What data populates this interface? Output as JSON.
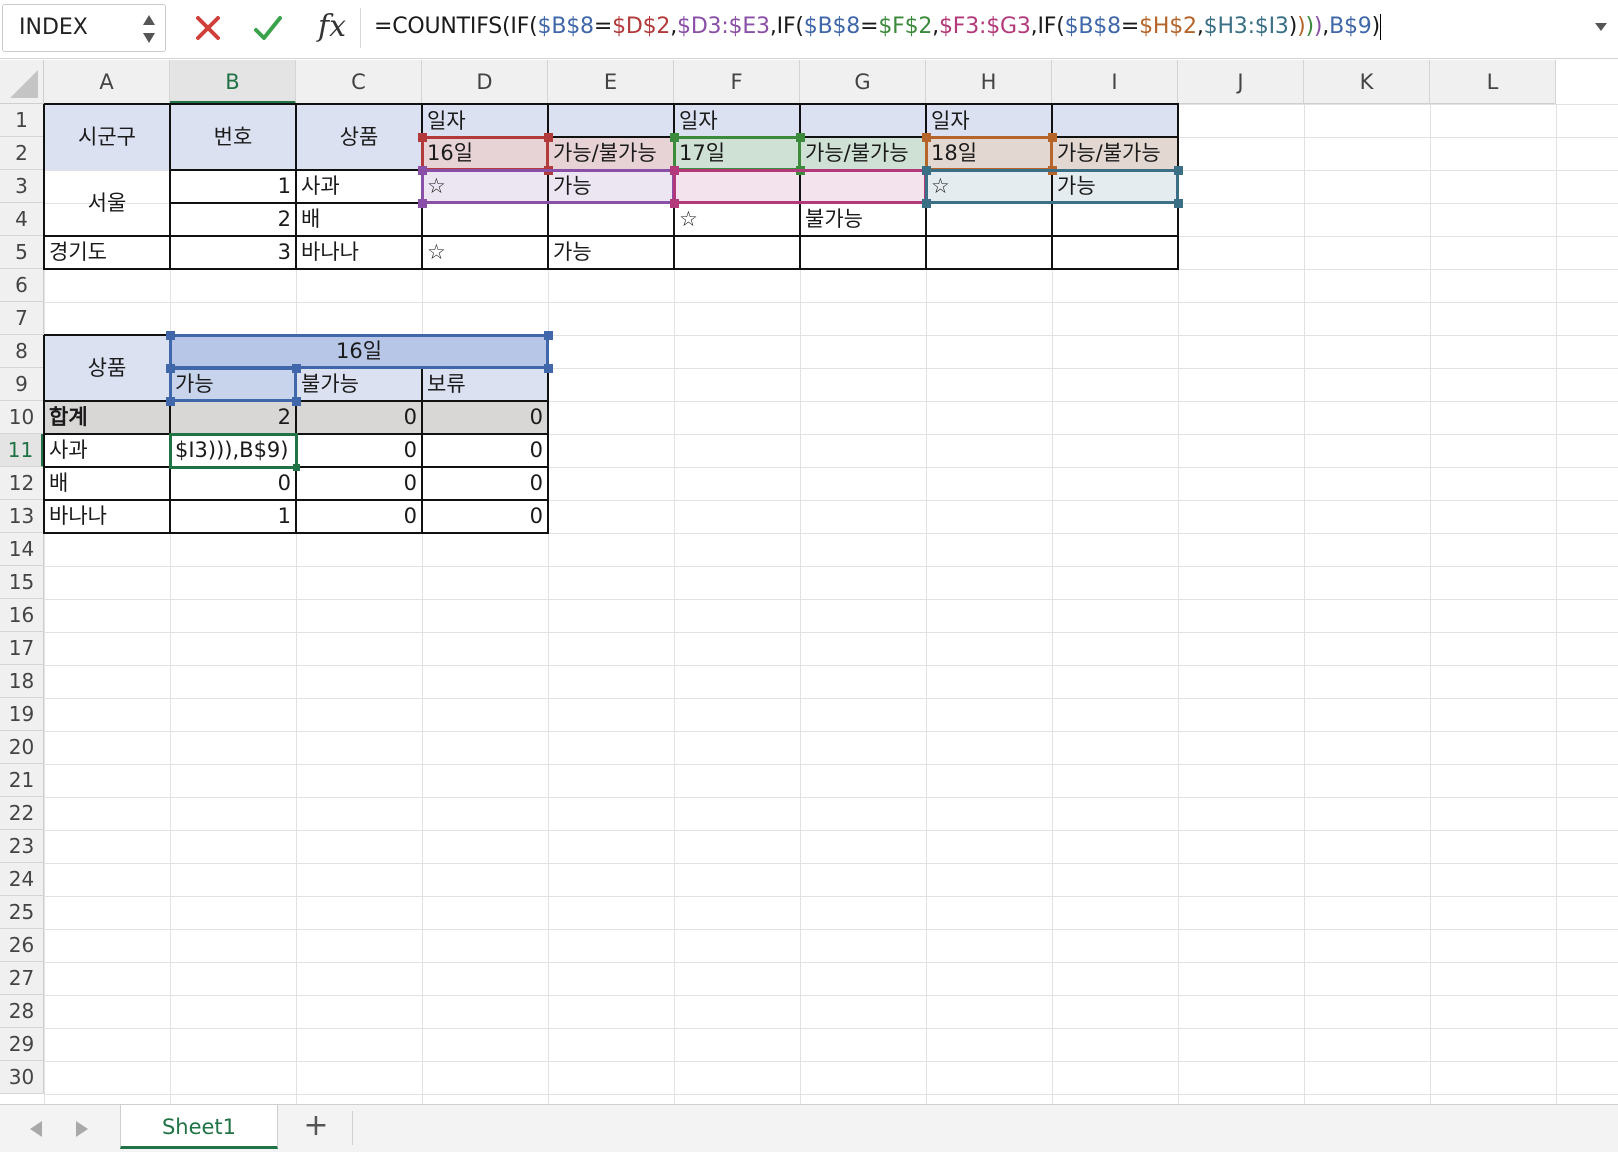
{
  "formula_bar": {
    "name_box": "INDEX",
    "cancel_icon": "x-icon",
    "enter_icon": "check-icon",
    "fx_label": "fx",
    "formula_segments": [
      {
        "text": "=COUNTIFS(IF(",
        "color": "#1a1a1a"
      },
      {
        "text": "$B$8",
        "color": "#3f67a9"
      },
      {
        "text": "=",
        "color": "#1a1a1a"
      },
      {
        "text": "$D$2",
        "color": "#b23a3a"
      },
      {
        "text": ",",
        "color": "#1a1a1a"
      },
      {
        "text": "$D3:$E3",
        "color": "#8a4fa6"
      },
      {
        "text": ",IF(",
        "color": "#1a1a1a"
      },
      {
        "text": "$B$8",
        "color": "#3f67a9"
      },
      {
        "text": "=",
        "color": "#1a1a1a"
      },
      {
        "text": "$F$2",
        "color": "#3c8a3c"
      },
      {
        "text": ",",
        "color": "#1a1a1a"
      },
      {
        "text": "$F3:$G3",
        "color": "#b23a7a"
      },
      {
        "text": ",IF(",
        "color": "#1a1a1a"
      },
      {
        "text": "$B$8",
        "color": "#3f67a9"
      },
      {
        "text": "=",
        "color": "#1a1a1a"
      },
      {
        "text": "$H$2",
        "color": "#b5652a"
      },
      {
        "text": ",",
        "color": "#1a1a1a"
      },
      {
        "text": "$H3:$I3",
        "color": "#3a6f86"
      },
      {
        "text": ")",
        "color": "#1a1a1a"
      },
      {
        "text": ")",
        "color": "#b5652a"
      },
      {
        "text": ")",
        "color": "#3c8a3c"
      },
      {
        "text": ")",
        "color": "#8a4fa6"
      },
      {
        "text": ",",
        "color": "#1a1a1a"
      },
      {
        "text": "B$9",
        "color": "#3f67a9"
      },
      {
        "text": ")",
        "color": "#1a1a1a"
      }
    ]
  },
  "columns": [
    "A",
    "B",
    "C",
    "D",
    "E",
    "F",
    "G",
    "H",
    "I",
    "J",
    "K",
    "L"
  ],
  "selected_column": "B",
  "rows": [
    "1",
    "2",
    "3",
    "4",
    "5",
    "6",
    "7",
    "8",
    "9",
    "10",
    "11",
    "12",
    "13",
    "14",
    "15",
    "16",
    "17",
    "18",
    "19",
    "20",
    "21",
    "22",
    "23",
    "24",
    "25",
    "26",
    "27",
    "28",
    "29",
    "30"
  ],
  "selected_row": "11",
  "cells": {
    "A1": "시군구",
    "B1": "번호",
    "C1": "상품",
    "D1": "일자",
    "F1": "일자",
    "H1": "일자",
    "D2": "16일",
    "E2": "가능/불가능",
    "F2": "17일",
    "G2": "가능/불가능",
    "H2": "18일",
    "I2": "가능/불가능",
    "A3": "서울",
    "B3": "1",
    "C3": "사과",
    "D3": "☆",
    "E3": "가능",
    "H3": "☆",
    "I3": "가능",
    "B4": "2",
    "C4": "배",
    "F4": "☆",
    "G4": "불가능",
    "A5": "경기도",
    "B5": "3",
    "C5": "바나나",
    "D5": "☆",
    "E5": "가능",
    "A8": "상품",
    "B8": "16일",
    "B9": "가능",
    "C9": "불가능",
    "D9": "보류",
    "A10": "합계",
    "B10": "2",
    "C10": "0",
    "D10": "0",
    "A11": "사과",
    "B11": "$I3))),B$9)",
    "C11": "0",
    "D11": "0",
    "A12": "배",
    "B12": "0",
    "C12": "0",
    "D12": "0",
    "A13": "바나나",
    "B13": "1",
    "C13": "0",
    "D13": "0"
  },
  "colors": {
    "header_fill": "#dce1f1",
    "total_fill": "#d9d6d6",
    "b8_fill": "#b7c5e6",
    "select_green": "#217346",
    "ref_blue": "#3f67a9",
    "ref_red": "#b23a3a",
    "ref_purple": "#8a4fa6",
    "ref_green": "#3c8a3c",
    "ref_magenta": "#b23a7a",
    "ref_orange": "#b5652a",
    "ref_teal": "#3a6f86"
  },
  "sheet_tabs": {
    "prev_icon": "triangle-left-icon",
    "next_icon": "triangle-right-icon",
    "active_tab": "Sheet1",
    "add_label": "+"
  }
}
